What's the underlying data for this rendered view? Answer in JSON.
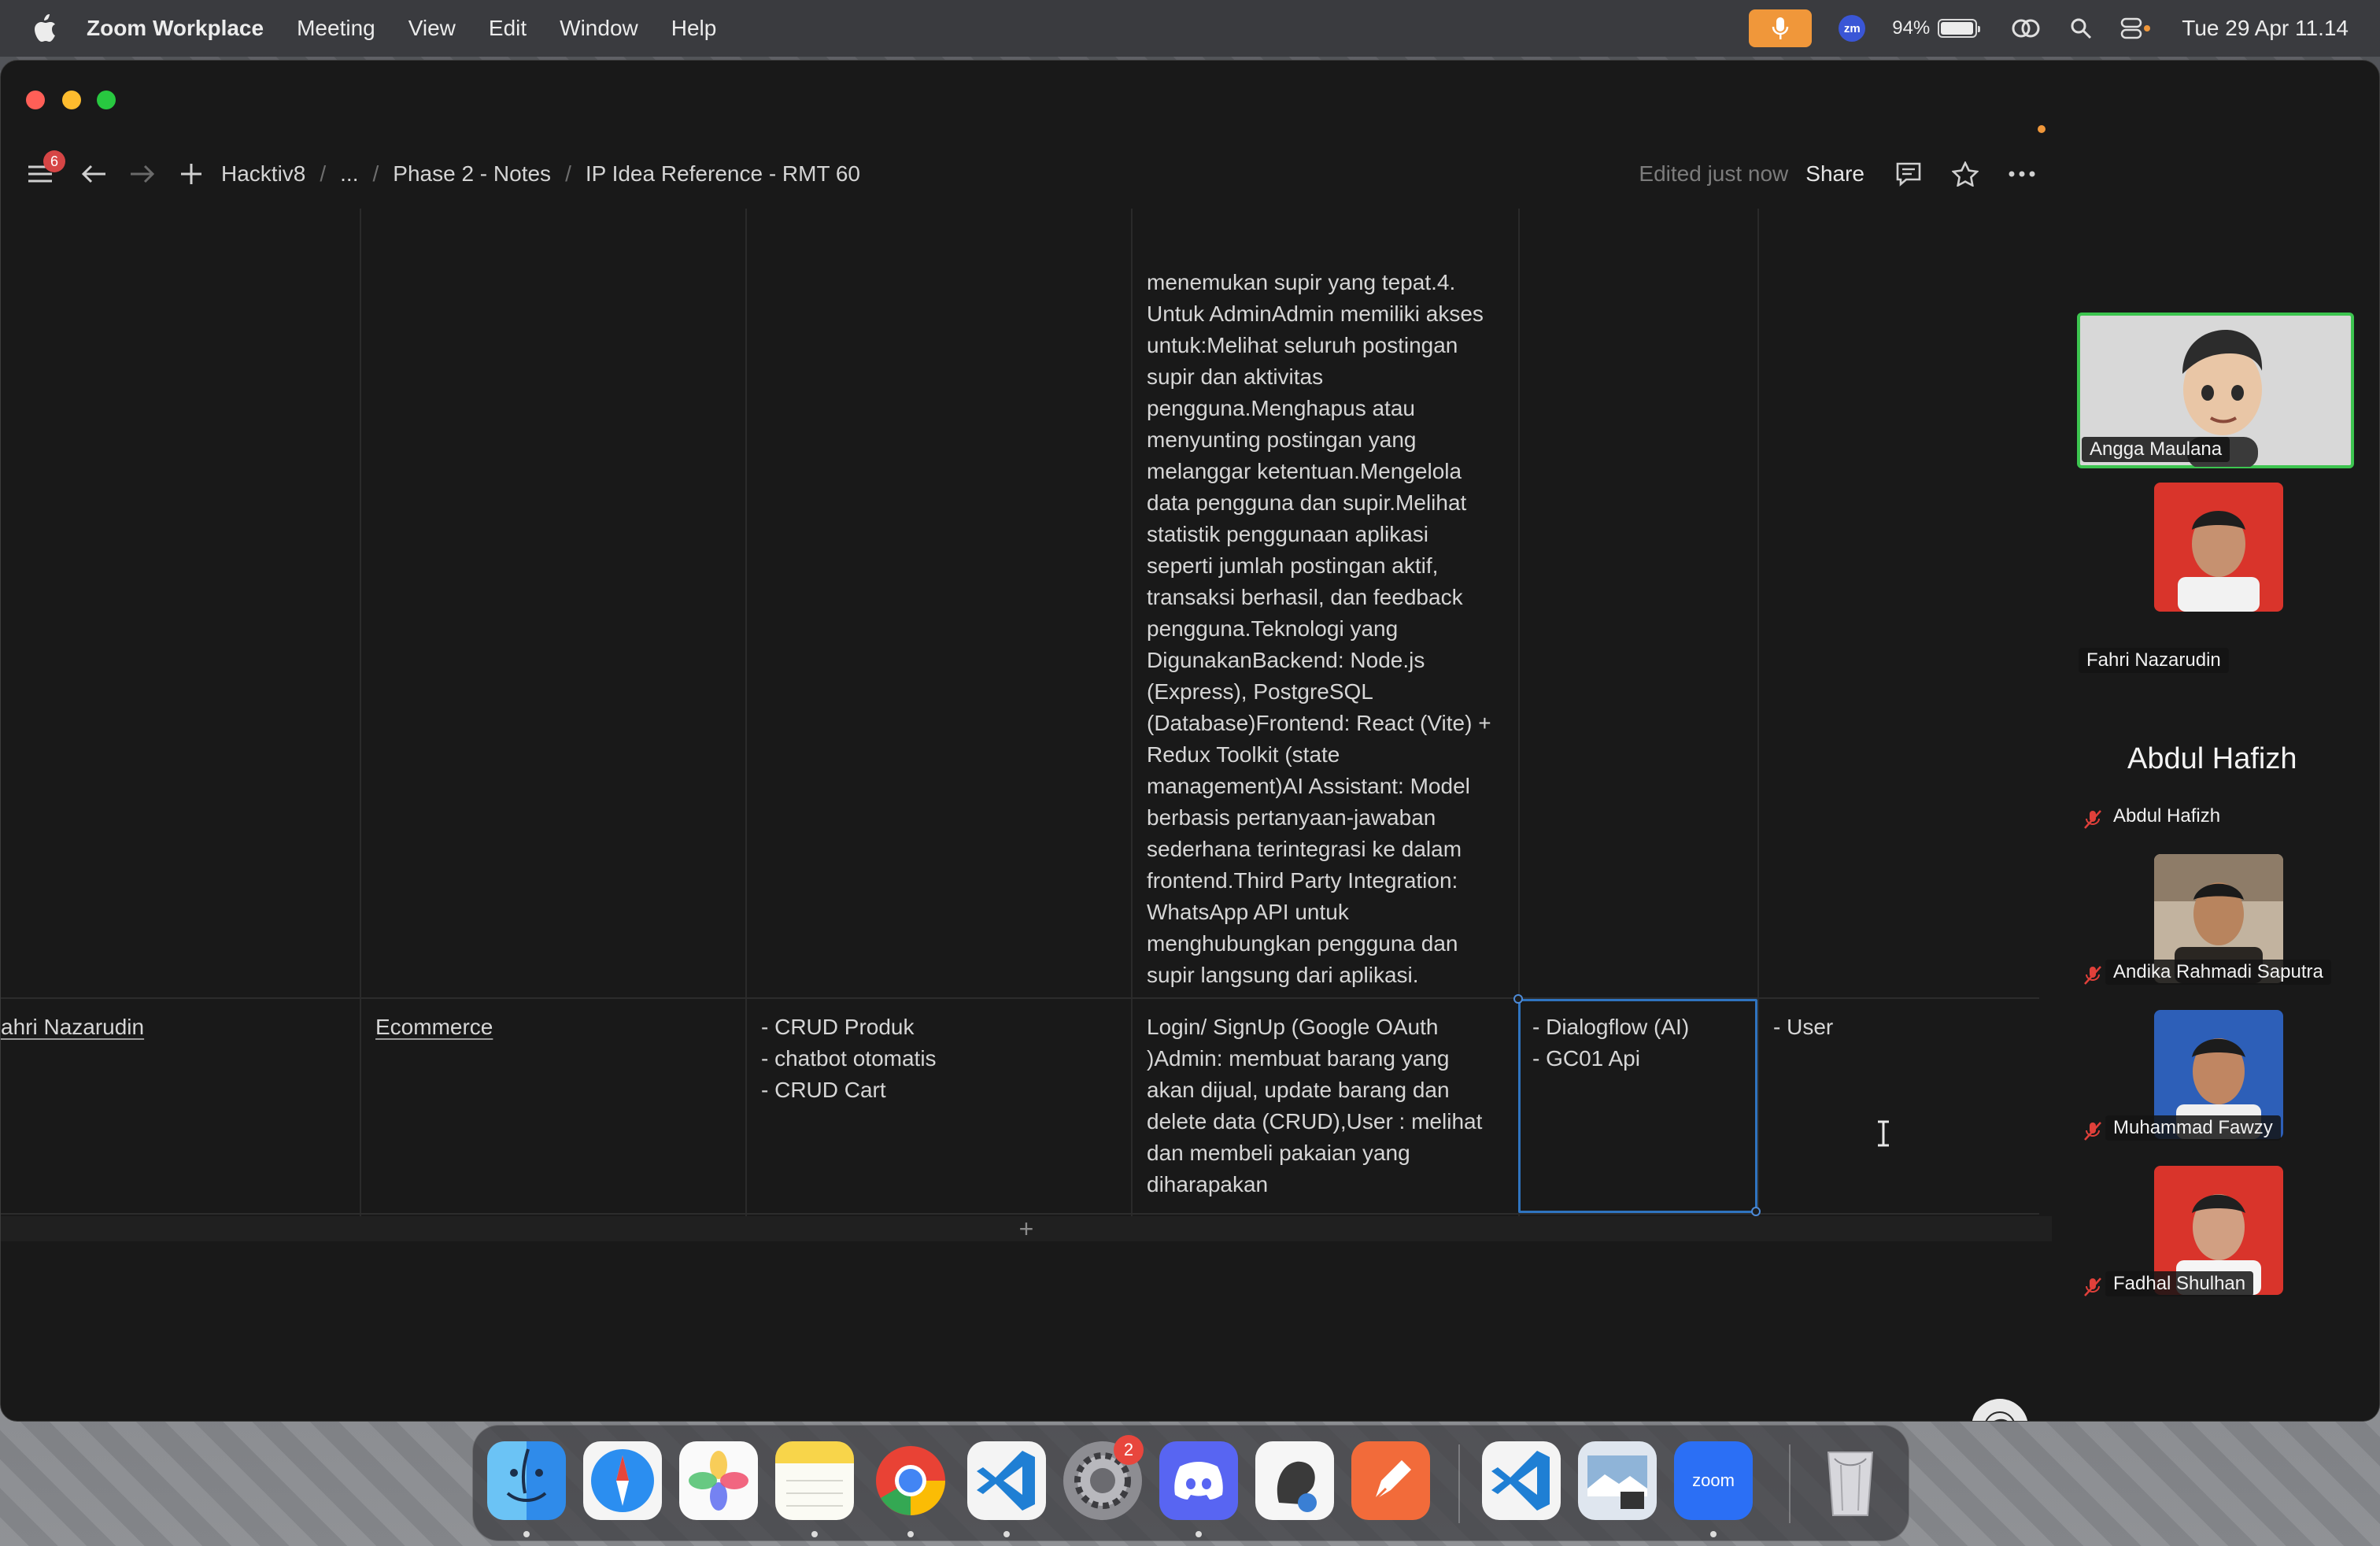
{
  "menubar": {
    "app_name": "Zoom Workplace",
    "menus": [
      "Meeting",
      "View",
      "Edit",
      "Window",
      "Help"
    ],
    "battery_percent": "94%",
    "clock": "Tue 29 Apr  11.14",
    "zoom_badge": "zm"
  },
  "topbar": {
    "notification_count": "6",
    "breadcrumb": [
      "Hacktiv8",
      "...",
      "Phase 2 - Notes",
      "IP Idea Reference - RMT 60"
    ],
    "edited_status": "Edited just now",
    "share_label": "Share"
  },
  "table": {
    "prev_row_cell": "menemukan supir yang tepat.4.\nUntuk AdminAdmin memiliki akses\nuntuk:Melihat seluruh postingan\nsupir dan aktivitas\npengguna.Menghapus atau\nmenyunting postingan yang\nmelanggar ketentuan.Mengelola\ndata pengguna dan supir.Melihat\nstatistik penggunaan aplikasi\nseperti jumlah postingan aktif,\ntransaksi berhasil, dan feedback\npengguna.Teknologi yang\nDigunakanBackend: Node.js\n(Express), PostgreSQL\n(Database)Frontend: React (Vite) +\nRedux Toolkit (state\nmanagement)AI Assistant: Model\nberbasis pertanyaan-jawaban\nsederhana terintegrasi ke dalam\nfrontend.Third Party Integration:\nWhatsApp API untuk\nmenghubungkan pengguna dan\nsupir langsung dari aplikasi.",
    "row": {
      "name": "ahri Nazarudin",
      "category": "Ecommerce",
      "features": "- CRUD Produk\n- chatbot otomatis\n- CRUD Cart",
      "description": "Login/ SignUp (Google OAuth\n)Admin: membuat barang yang\nakan dijual, update barang dan\ndelete data (CRUD),User : melihat\ndan membeli pakaian yang\ndiharapakan",
      "third_party": "- Dialogflow (AI)\n- GC01 Api",
      "roles": "- User"
    },
    "add_row_symbol": "+"
  },
  "participants": {
    "active_speaker": "Angga Maulana",
    "list": [
      {
        "name": "Fahri Nazarudin"
      },
      {
        "name": "Abdul Hafizh",
        "big_name": "Abdul Hafizh"
      },
      {
        "name": "Andika Rahmadi Saputra"
      },
      {
        "name": "Muhammad Fawzy"
      },
      {
        "name": "Fadhal Shulhan"
      }
    ]
  },
  "dock": {
    "apps": [
      "finder",
      "safari",
      "photos",
      "notes",
      "chrome",
      "vscode",
      "system-settings",
      "discord",
      "tableplus",
      "postman",
      "vscode-2",
      "preview",
      "zoom",
      "trash"
    ],
    "settings_badge": "2",
    "zoom_label": "zoom"
  },
  "colors": {
    "accent_blue": "#2f74c0",
    "active_green": "#3cc44f",
    "mic_orange": "#f0973a"
  }
}
